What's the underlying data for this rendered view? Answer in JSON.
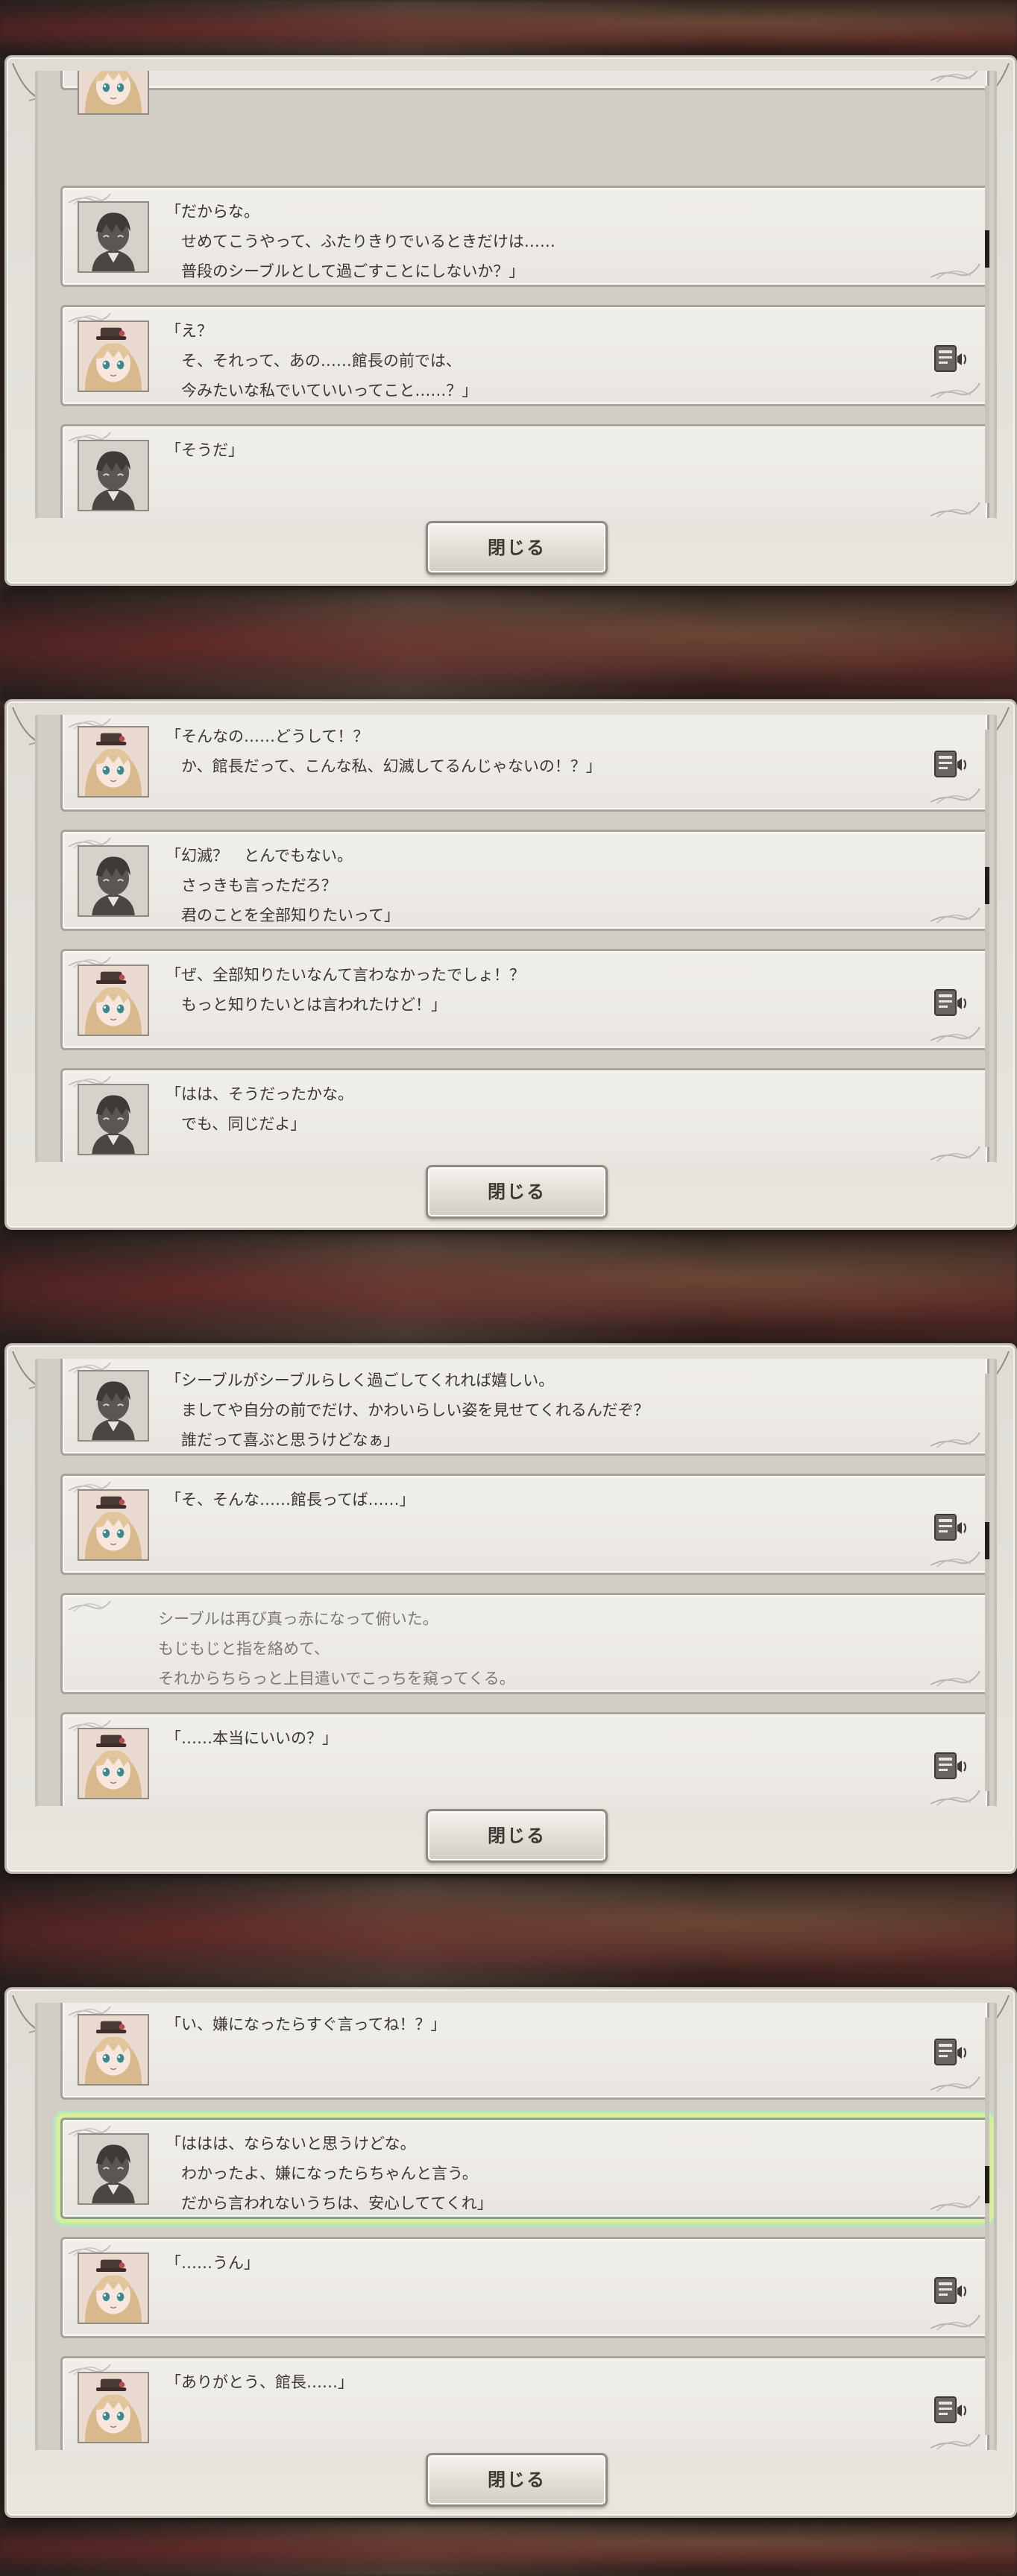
{
  "close_label": "閉じる",
  "colors": {
    "panel": "#e8e5df",
    "entry_bg": "#f1efeb",
    "entry_border": "#a7a39c",
    "text": "#3a3632",
    "narration_text": "#7c7872",
    "highlight": "#d8ee9a"
  },
  "panels": [
    {
      "scroll_fraction": 0.38,
      "entries": [
        {
          "speaker": "",
          "text": "",
          "voice": false,
          "kind": "partial"
        },
        {
          "speaker": "manager",
          "text": "「だからな。\n　せめてこうやって、ふたりきりでいるときだけは……\n　普段のシーブルとして過ごすことにしないか？」",
          "voice": false
        },
        {
          "speaker": "sieble",
          "text": "「え？\n　そ、それって、あの……館長の前では、\n　今みたいな私でいていいってこと……？」",
          "voice": true
        },
        {
          "speaker": "manager",
          "text": "「そうだ」",
          "voice": false
        },
        {
          "speaker": "",
          "text": "",
          "voice": false,
          "kind": "partial"
        }
      ]
    },
    {
      "scroll_fraction": 0.36,
      "entries": [
        {
          "speaker": "sieble",
          "text": "「そんなの……どうして！？\n　か、館長だって、こんな私、幻滅してるんじゃないの！？」",
          "voice": true
        },
        {
          "speaker": "manager",
          "text": "「幻滅？　とんでもない。\n　さっきも言っただろ？\n　君のことを全部知りたいって」",
          "voice": false
        },
        {
          "speaker": "sieble",
          "text": "「ぜ、全部知りたいなんて言わなかったでしょ！？\n　もっと知りたいとは言われたけど！」",
          "voice": true
        },
        {
          "speaker": "manager",
          "text": "「はは、そうだったかな。\n　でも、同じだよ」",
          "voice": false
        }
      ]
    },
    {
      "scroll_fraction": 0.39,
      "entries": [
        {
          "speaker": "manager",
          "text": "「シーブルがシーブルらしく過ごしてくれれば嬉しい。\n　ましてや自分の前でだけ、かわいらしい姿を見せてくれるんだぞ？\n　誰だって喜ぶと思うけどなぁ」",
          "voice": false
        },
        {
          "speaker": "sieble",
          "text": "「そ、そんな……館長ってば……」",
          "voice": true
        },
        {
          "speaker": "",
          "text": "シーブルは再び真っ赤になって俯いた。\nもじもじと指を絡めて、\nそれからちらっと上目遣いでこっちを窺ってくる。",
          "voice": false,
          "kind": "narration"
        },
        {
          "speaker": "sieble",
          "text": "「……本当にいいの？」",
          "voice": true
        }
      ]
    },
    {
      "scroll_fraction": 0.39,
      "entries": [
        {
          "speaker": "sieble",
          "text": "「い、嫌になったらすぐ言ってね！？」",
          "voice": true
        },
        {
          "speaker": "manager",
          "text": "「ははは、ならないと思うけどな。\n　わかったよ、嫌になったらちゃんと言う。\n　だから言われないうちは、安心しててくれ」",
          "voice": false,
          "highlight": true
        },
        {
          "speaker": "sieble",
          "text": "「……うん」",
          "voice": true
        },
        {
          "speaker": "sieble",
          "text": "「ありがとう、館長……」",
          "voice": true
        }
      ]
    }
  ]
}
